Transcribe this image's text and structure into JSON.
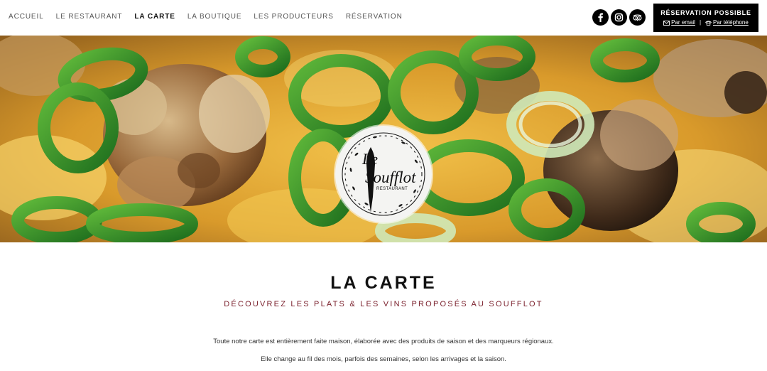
{
  "nav": {
    "items": [
      {
        "label": "ACCUEIL",
        "active": false
      },
      {
        "label": "LE RESTAURANT",
        "active": false
      },
      {
        "label": "LA CARTE",
        "active": true
      },
      {
        "label": "LA BOUTIQUE",
        "active": false
      },
      {
        "label": "LES PRODUCTEURS",
        "active": false
      },
      {
        "label": "RÉSERVATION",
        "active": false
      }
    ]
  },
  "socials": {
    "icons": [
      "facebook-icon",
      "instagram-icon",
      "tripadvisor-icon"
    ]
  },
  "reservation": {
    "title": "RÉSERVATION POSSIBLE",
    "email_label": "Par email",
    "separator": "|",
    "phone_label": "Par téléphone"
  },
  "logo": {
    "line1": "Le",
    "line2": "Soufflot",
    "line3": "RESTAURANT"
  },
  "content": {
    "title": "LA CARTE",
    "subtitle": "DÉCOUVREZ LES PLATS & LES VINS PROPOSÉS AU SOUFFLOT",
    "paragraph1": "Toute notre carte est entièrement faite maison, élaborée avec des produits de saison et des marqueurs régionaux.",
    "paragraph2": "Elle change au fil des mois, parfois des semaines, selon les arrivages et la saison."
  },
  "colors": {
    "accent": "#7a1f2b",
    "header_button_bg": "#000000",
    "nav_active": "#111111",
    "nav_default": "#555555"
  }
}
